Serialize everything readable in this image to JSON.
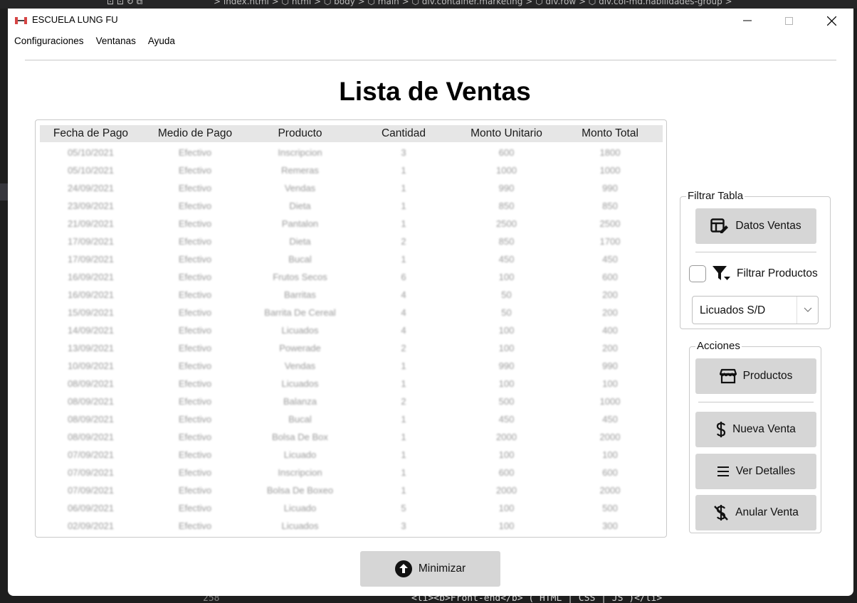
{
  "background": {
    "breadcrumb": "> index.html > ⬡ html > ⬡ body > ⬡ main > ⬡ div.container.marketing > ⬡ div.row > ⬡ div.col-md.habilidades-group >",
    "line_number": "258",
    "code_snippet": "<li><b>Front-end</b> ( HTML | CSS | JS )</li>"
  },
  "window": {
    "title": "ESCUELA LUNG FU",
    "controls": {
      "minimize": "—",
      "maximize": "☐",
      "close": "✕"
    }
  },
  "menu": [
    "Configuraciones",
    "Ventanas",
    "Ayuda"
  ],
  "page_title": "Lista de Ventas",
  "table": {
    "headers": [
      "Fecha de Pago",
      "Medio de Pago",
      "Producto",
      "Cantidad",
      "Monto Unitario",
      "Monto Total"
    ],
    "rows": [
      [
        "05/10/2021",
        "Efectivo",
        "Inscripcion",
        "3",
        "600",
        "1800"
      ],
      [
        "05/10/2021",
        "Efectivo",
        "Remeras",
        "1",
        "1000",
        "1000"
      ],
      [
        "24/09/2021",
        "Efectivo",
        "Vendas",
        "1",
        "990",
        "990"
      ],
      [
        "23/09/2021",
        "Efectivo",
        "Dieta",
        "1",
        "850",
        "850"
      ],
      [
        "21/09/2021",
        "Efectivo",
        "Pantalon",
        "1",
        "2500",
        "2500"
      ],
      [
        "17/09/2021",
        "Efectivo",
        "Dieta",
        "2",
        "850",
        "1700"
      ],
      [
        "17/09/2021",
        "Efectivo",
        "Bucal",
        "1",
        "450",
        "450"
      ],
      [
        "16/09/2021",
        "Efectivo",
        "Frutos Secos",
        "6",
        "100",
        "600"
      ],
      [
        "16/09/2021",
        "Efectivo",
        "Barritas",
        "4",
        "50",
        "200"
      ],
      [
        "15/09/2021",
        "Efectivo",
        "Barrita De Cereal",
        "4",
        "50",
        "200"
      ],
      [
        "14/09/2021",
        "Efectivo",
        "Licuados",
        "4",
        "100",
        "400"
      ],
      [
        "13/09/2021",
        "Efectivo",
        "Powerade",
        "2",
        "100",
        "200"
      ],
      [
        "10/09/2021",
        "Efectivo",
        "Vendas",
        "1",
        "990",
        "990"
      ],
      [
        "08/09/2021",
        "Efectivo",
        "Licuados",
        "1",
        "100",
        "100"
      ],
      [
        "08/09/2021",
        "Efectivo",
        "Balanza",
        "2",
        "500",
        "1000"
      ],
      [
        "08/09/2021",
        "Efectivo",
        "Bucal",
        "1",
        "450",
        "450"
      ],
      [
        "08/09/2021",
        "Efectivo",
        "Bolsa De Box",
        "1",
        "2000",
        "2000"
      ],
      [
        "07/09/2021",
        "Efectivo",
        "Licuado",
        "1",
        "100",
        "100"
      ],
      [
        "07/09/2021",
        "Efectivo",
        "Inscripcion",
        "1",
        "600",
        "600"
      ],
      [
        "07/09/2021",
        "Efectivo",
        "Bolsa De Boxeo",
        "1",
        "2000",
        "2000"
      ],
      [
        "06/09/2021",
        "Efectivo",
        "Licuado",
        "5",
        "100",
        "500"
      ],
      [
        "02/09/2021",
        "Efectivo",
        "Licuados",
        "3",
        "100",
        "300"
      ]
    ]
  },
  "filter_panel": {
    "title": "Filtrar Tabla",
    "datos_ventas_label": "Datos Ventas",
    "filtrar_productos_label": "Filtrar Productos",
    "filtrar_productos_checked": false,
    "product_select_value": "Licuados S/D"
  },
  "actions_panel": {
    "title": "Acciones",
    "productos_label": "Productos",
    "nueva_venta_label": "Nueva Venta",
    "ver_detalles_label": "Ver Detalles",
    "anular_venta_label": "Anular Venta"
  },
  "minimize_button_label": "Minimizar",
  "colors": {
    "button_bg": "#d6d6d6",
    "header_bg": "#e6e6e6",
    "border": "#c9c9c9"
  }
}
